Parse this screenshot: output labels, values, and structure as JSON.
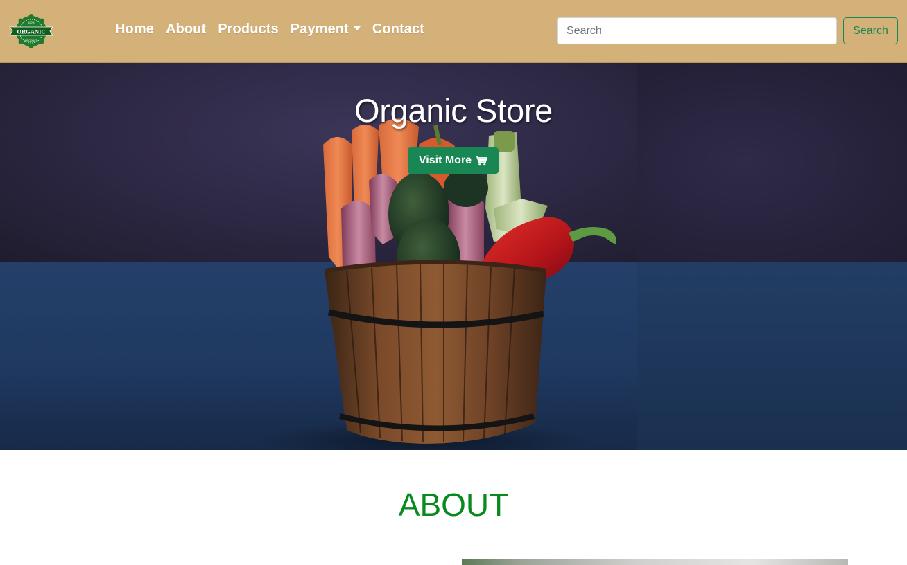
{
  "navbar": {
    "brand": {
      "logo_icon": "organic-badge-icon",
      "logo_text": "ORGANIC",
      "logo_top_text": "100%",
      "logo_bottom_text": "PRODUCT"
    },
    "links": [
      {
        "label": "Home"
      },
      {
        "label": "About"
      },
      {
        "label": "Products"
      },
      {
        "label": "Payment",
        "has_dropdown": true
      },
      {
        "label": "Contact"
      }
    ],
    "search": {
      "placeholder": "Search",
      "button_label": "Search"
    }
  },
  "hero": {
    "title": "Organic Store",
    "button_label": "Visit More",
    "button_icon": "cart-icon"
  },
  "about": {
    "title": "ABOUT"
  },
  "colors": {
    "navbar_bg": "#d5b17a",
    "primary_green": "#198754",
    "heading_green": "#0a8a1e"
  }
}
